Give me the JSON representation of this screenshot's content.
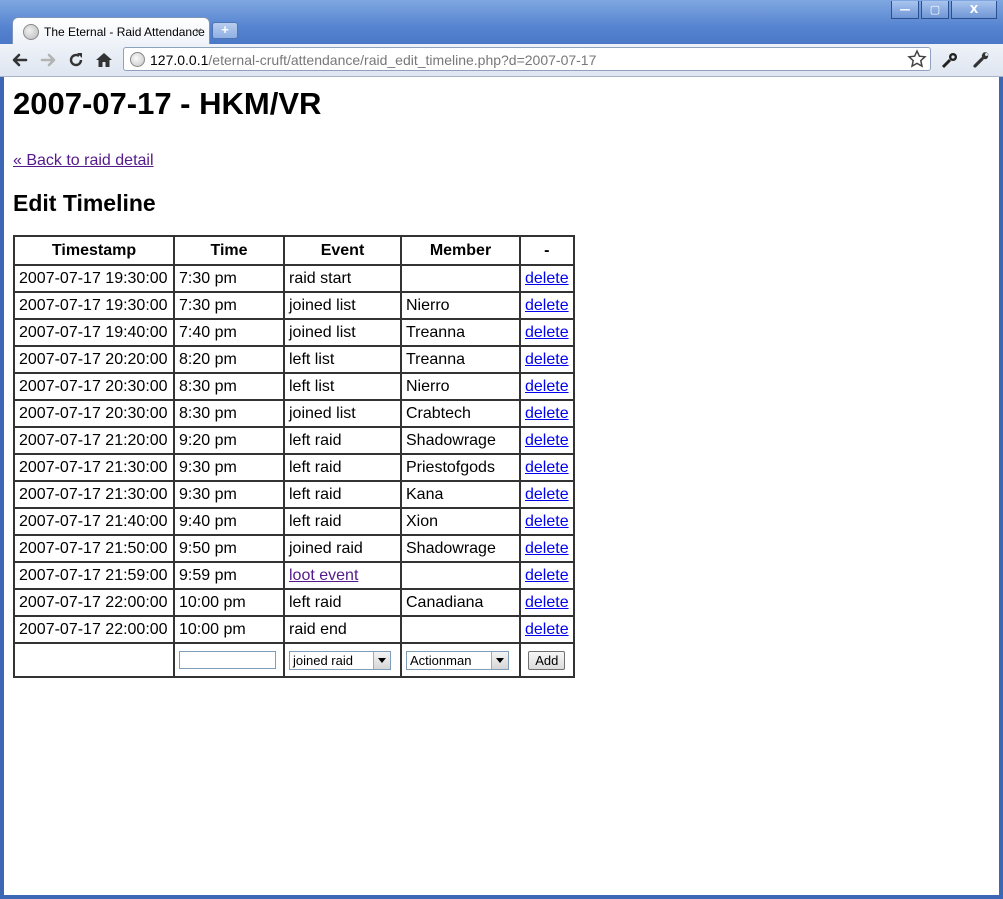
{
  "browser": {
    "tab_title": "The Eternal - Raid Attendance",
    "tab_close": "×",
    "new_tab": "+",
    "url_host": "127.0.0.1",
    "url_path": "/eternal-cruft/attendance/raid_edit_timeline.php?d=2007-07-17",
    "window_buttons": {
      "minimize": "—",
      "maximize": "▢",
      "close": "X"
    }
  },
  "page": {
    "title": "2007-07-17 - HKM/VR",
    "back_link": "« Back to raid detail",
    "section_title": "Edit Timeline"
  },
  "table": {
    "headers": [
      "Timestamp",
      "Time",
      "Event",
      "Member",
      "-"
    ],
    "rows": [
      {
        "timestamp": "2007-07-17 19:30:00",
        "time": "7:30 pm",
        "event": "raid start",
        "member": "",
        "action": "delete"
      },
      {
        "timestamp": "2007-07-17 19:30:00",
        "time": "7:30 pm",
        "event": "joined list",
        "member": "Nierro",
        "action": "delete"
      },
      {
        "timestamp": "2007-07-17 19:40:00",
        "time": "7:40 pm",
        "event": "joined list",
        "member": "Treanna",
        "action": "delete"
      },
      {
        "timestamp": "2007-07-17 20:20:00",
        "time": "8:20 pm",
        "event": "left list",
        "member": "Treanna",
        "action": "delete"
      },
      {
        "timestamp": "2007-07-17 20:30:00",
        "time": "8:30 pm",
        "event": "left list",
        "member": "Nierro",
        "action": "delete"
      },
      {
        "timestamp": "2007-07-17 20:30:00",
        "time": "8:30 pm",
        "event": "joined list",
        "member": "Crabtech",
        "action": "delete"
      },
      {
        "timestamp": "2007-07-17 21:20:00",
        "time": "9:20 pm",
        "event": "left raid",
        "member": "Shadowrage",
        "action": "delete"
      },
      {
        "timestamp": "2007-07-17 21:30:00",
        "time": "9:30 pm",
        "event": "left raid",
        "member": "Priestofgods",
        "action": "delete"
      },
      {
        "timestamp": "2007-07-17 21:30:00",
        "time": "9:30 pm",
        "event": "left raid",
        "member": "Kana",
        "action": "delete"
      },
      {
        "timestamp": "2007-07-17 21:40:00",
        "time": "9:40 pm",
        "event": "left raid",
        "member": "Xion",
        "action": "delete"
      },
      {
        "timestamp": "2007-07-17 21:50:00",
        "time": "9:50 pm",
        "event": "joined raid",
        "member": "Shadowrage",
        "action": "delete"
      },
      {
        "timestamp": "2007-07-17 21:59:00",
        "time": "9:59 pm",
        "event": "loot event",
        "member": "",
        "action": "delete"
      },
      {
        "timestamp": "2007-07-17 22:00:00",
        "time": "10:00 pm",
        "event": "left raid",
        "member": "Canadiana",
        "action": "delete"
      },
      {
        "timestamp": "2007-07-17 22:00:00",
        "time": "10:00 pm",
        "event": "raid end",
        "member": "",
        "action": "delete"
      }
    ],
    "add_form": {
      "time_value": "",
      "event_selected": "joined raid",
      "member_selected": "Actionman",
      "add_label": "Add"
    }
  },
  "colors": {
    "link_unvisited": "#0000ee",
    "link_visited": "#551a8b",
    "frame_blue": "#3b67b5"
  }
}
